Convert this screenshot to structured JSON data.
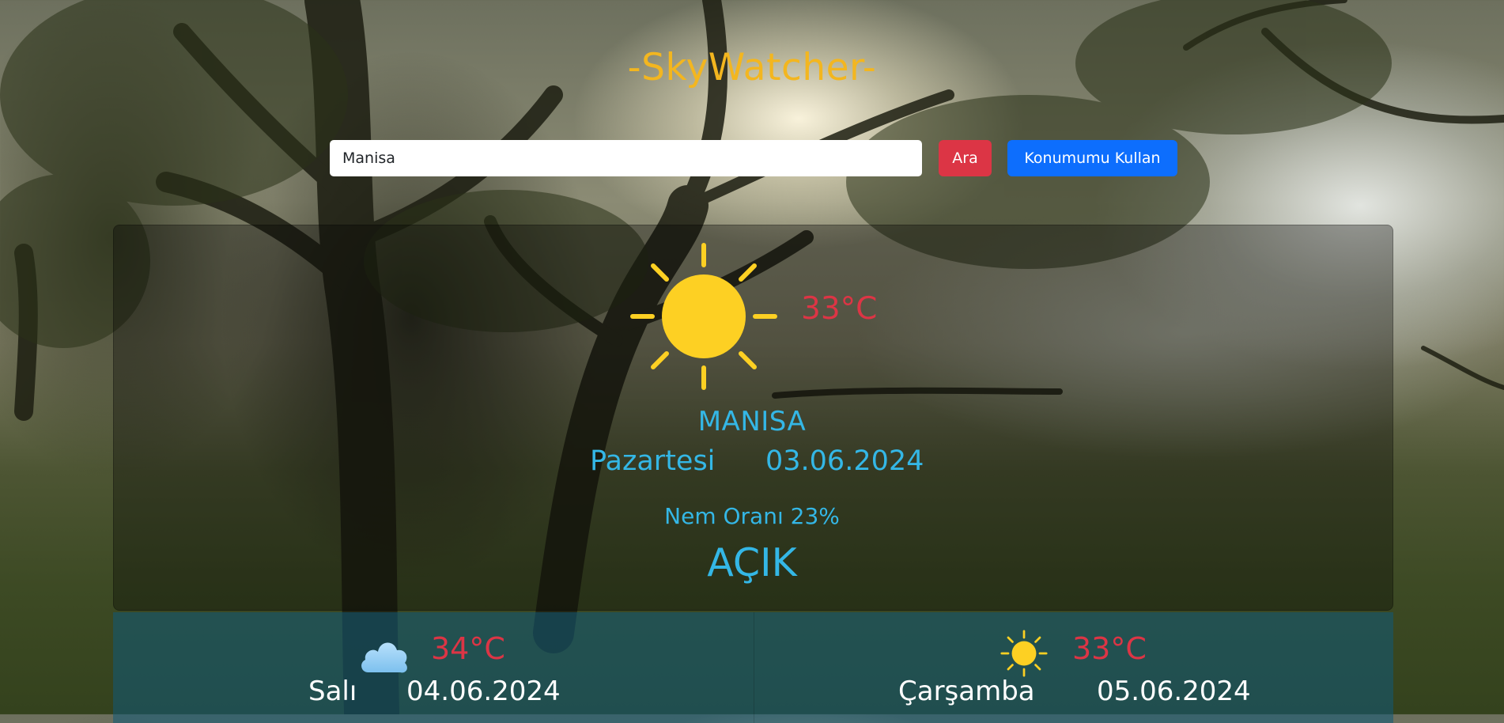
{
  "header": {
    "title": "-SkyWatcher-"
  },
  "search": {
    "value": "Manisa",
    "search_label": "Ara",
    "location_label": "Konumumu Kullan"
  },
  "current": {
    "icon": "sun-icon",
    "temperature": "33°C",
    "city": "MANISA",
    "day": "Pazartesi",
    "date": "03.06.2024",
    "humidity": "Nem Oranı 23%",
    "condition": "AÇIK"
  },
  "forecast": [
    {
      "icon": "cloud-icon",
      "temperature": "34°C",
      "day": "Salı",
      "date": "04.06.2024"
    },
    {
      "icon": "sun-icon",
      "temperature": "33°C",
      "day": "Çarşamba",
      "date": "05.06.2024"
    }
  ],
  "colors": {
    "title": "#f3b61f",
    "search_button": "#dc3545",
    "location_button": "#0d6efd",
    "temperature": "#dc3545",
    "info_text": "#34b7e6",
    "sun": "#fdd023"
  }
}
